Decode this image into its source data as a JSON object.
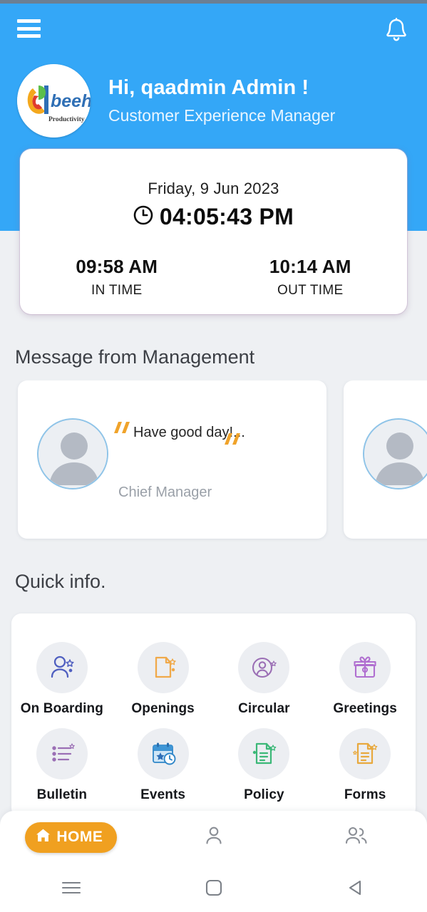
{
  "header": {
    "menu_icon": "hamburger-menu-icon",
    "notification_icon": "bell-icon",
    "logo_name": "beehive",
    "logo_tagline": "Productivity Catalysts",
    "greeting": "Hi, qaadmin Admin !",
    "role": "Customer Experience Manager",
    "background_color": "#34a7f7"
  },
  "time_card": {
    "date": "Friday, 9 Jun 2023",
    "clock_icon": "clock-icon",
    "current_time": "04:05:43 PM",
    "in_time_value": "09:58 AM",
    "in_time_label": "IN TIME",
    "out_time_value": "10:14 AM",
    "out_time_label": "OUT TIME"
  },
  "messages": {
    "section_title": "Message from Management",
    "quote_color": "#f0a32a",
    "cards": [
      {
        "text": "Have good day!...",
        "role": "Chief Manager",
        "avatar": "avatar-placeholder-icon"
      },
      {
        "text": "",
        "role": "",
        "avatar": "avatar-placeholder-icon"
      }
    ]
  },
  "quick_info": {
    "section_title": "Quick info.",
    "rows": [
      [
        {
          "label": "On Boarding",
          "icon": "user-add-icon",
          "color": "#4f5fc0"
        },
        {
          "label": "Openings",
          "icon": "document-openings-icon",
          "color": "#f0a94a"
        },
        {
          "label": "Circular",
          "icon": "user-circle-icon",
          "color": "#9b6fb5"
        },
        {
          "label": "Greetings",
          "icon": "gift-icon",
          "color": "#b06fd0"
        }
      ],
      [
        {
          "label": "Bulletin",
          "icon": "list-bullet-icon",
          "color": "#9b6fb5"
        },
        {
          "label": "Events",
          "icon": "calendar-clock-icon",
          "color": "#2f86c8"
        },
        {
          "label": "Policy",
          "icon": "document-check-icon",
          "color": "#3cb878"
        },
        {
          "label": "Forms",
          "icon": "document-form-icon",
          "color": "#e8a93e"
        }
      ]
    ]
  },
  "bottom_nav": {
    "active_color": "#f0a020",
    "items": [
      {
        "label": "HOME",
        "icon": "home-icon",
        "active": true
      },
      {
        "label": "",
        "icon": "person-icon",
        "active": false
      },
      {
        "label": "",
        "icon": "people-icon",
        "active": false
      }
    ]
  },
  "system_nav": {
    "items": [
      {
        "icon": "recents-menu-icon"
      },
      {
        "icon": "home-square-icon"
      },
      {
        "icon": "back-triangle-icon"
      }
    ]
  }
}
